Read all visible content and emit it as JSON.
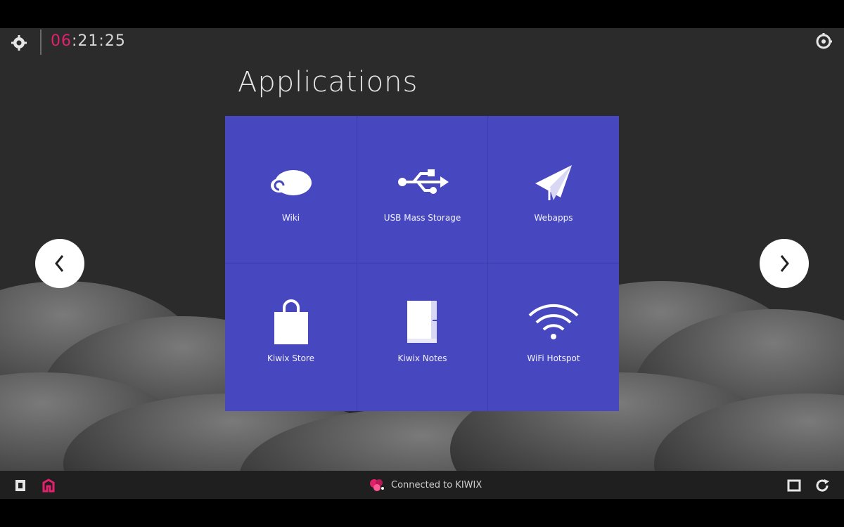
{
  "topbar": {
    "time_accent": "06",
    "time_rest": ":21:25"
  },
  "page": {
    "title": "Applications"
  },
  "tiles": [
    {
      "label": "Wiki",
      "icon": "cloud-icon"
    },
    {
      "label": "USB Mass Storage",
      "icon": "usb-icon"
    },
    {
      "label": "Webapps",
      "icon": "paper-plane-icon"
    },
    {
      "label": "Kiwix Store",
      "icon": "shopping-bag-icon"
    },
    {
      "label": "Kiwix Notes",
      "icon": "notebook-icon"
    },
    {
      "label": "WiFi Hotspot",
      "icon": "wifi-icon"
    }
  ],
  "bottombar": {
    "status_text": "Connected to KIWIX"
  },
  "colors": {
    "accent": "#e0226d",
    "tile_background": "#4747c0",
    "screen_background": "#2b2b2b"
  }
}
